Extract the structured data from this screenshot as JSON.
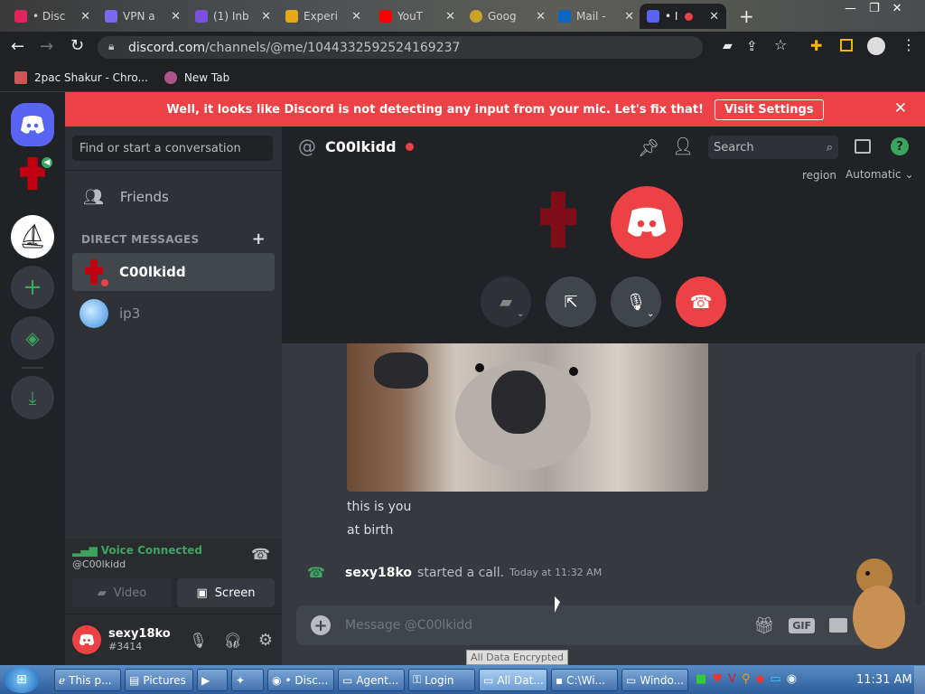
{
  "browser": {
    "tabs": [
      {
        "label": "• Disc",
        "active": false,
        "color": "#e0245e"
      },
      {
        "label": "VPN a",
        "active": false,
        "color": "#7b68ee"
      },
      {
        "label": "(1) Inb",
        "active": false,
        "color": "#7b4fe0"
      },
      {
        "label": "Experi",
        "active": false,
        "color": "#e6a817"
      },
      {
        "label": "YouT",
        "active": false,
        "color": "#ff0000"
      },
      {
        "label": "Goog",
        "active": false,
        "color": "#c9a227"
      },
      {
        "label": "Mail -",
        "active": false,
        "color": "#0a66c2"
      },
      {
        "label": "• I",
        "active": true,
        "color": "#5865f2"
      }
    ],
    "url_host": "discord.com",
    "url_path": "/channels/@me/1044332592524169237",
    "bookmarks": [
      "2pac Shakur - Chro...",
      "New Tab"
    ]
  },
  "notice": {
    "text": "Well, it looks like Discord is not detecting any input from your mic. Let's fix that!",
    "button": "Visit Settings"
  },
  "dm": {
    "search_placeholder": "Find or start a conversation",
    "friends_label": "Friends",
    "section_label": "DIRECT MESSAGES",
    "items": [
      {
        "name": "C00lkidd",
        "selected": true
      },
      {
        "name": "ip3",
        "selected": false
      }
    ]
  },
  "voice": {
    "status": "Voice Connected",
    "channel": "@C00lkidd",
    "video_label": "Video",
    "screen_label": "Screen"
  },
  "user": {
    "name": "sexy18ko",
    "tag": "#3414"
  },
  "header": {
    "channel": "C00lkidd",
    "search_placeholder": "Search",
    "region_label": "region",
    "region_value": "Automatic"
  },
  "messages": [
    {
      "text": "this is you"
    },
    {
      "text": "at birth"
    }
  ],
  "system_message": {
    "author": "sexy18ko",
    "action": "started a call.",
    "time": "Today at 11:32 AM"
  },
  "composer": {
    "placeholder": "Message @C00lkidd",
    "gif_label": "GIF"
  },
  "tooltip": "All Data Encrypted",
  "taskbar": {
    "items": [
      "This p...",
      "Pictures",
      "",
      "",
      "• Disc...",
      "Agent...",
      "Login",
      "All Dat...",
      "C:\\Wi...",
      "Windo..."
    ],
    "clock": "11:31 AM"
  },
  "colors": {
    "blurple": "#5865f2",
    "red": "#ed4245",
    "green": "#3ba55d"
  }
}
